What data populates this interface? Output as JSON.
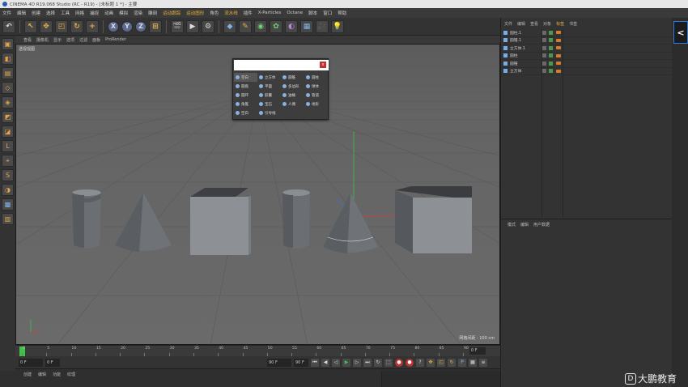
{
  "title_bar": {
    "text": "CINEMA 4D R19.068 Studio (RC - R19) - [未标题 1 *] - 主要"
  },
  "menu": {
    "items": [
      "文件",
      "编辑",
      "创建",
      "选择",
      "工具",
      "网格",
      "捕捉",
      "动画",
      "模拟",
      "渲染",
      "雕刻",
      "运动跟踪",
      "运动图形",
      "角色",
      "流水线",
      "插件",
      "X-Particles",
      "Octane",
      "脚本",
      "窗口",
      "帮助"
    ],
    "highlighted": [
      "运动跟踪",
      "运动图形",
      "流水线"
    ]
  },
  "toolbar": {
    "undo_icon": "undo-icon",
    "axis_labels": [
      "X",
      "Y",
      "Z"
    ]
  },
  "viewport": {
    "menu": [
      "查看",
      "摄像机",
      "显示",
      "选项",
      "过滤",
      "面板",
      "ProRender"
    ],
    "label": "透视视图",
    "grid_info": "网格间距 : 100 cm",
    "colors": {
      "background": "#646464",
      "grid": "#595959",
      "y_axis": "#3fc24a",
      "x_axis": "#d43c3c"
    }
  },
  "popup": {
    "search_value": "",
    "close_label": "x",
    "items": [
      {
        "label": "空白",
        "selected": true
      },
      {
        "label": "立方体"
      },
      {
        "label": "圆锥"
      },
      {
        "label": "圆柱"
      },
      {
        "label": "圆盘"
      },
      {
        "label": "平面"
      },
      {
        "label": "多边形"
      },
      {
        "label": "球体"
      },
      {
        "label": "圆环"
      },
      {
        "label": "胶囊"
      },
      {
        "label": "油桶"
      },
      {
        "label": "管道"
      },
      {
        "label": "角锥"
      },
      {
        "label": "宝石"
      },
      {
        "label": "人偶"
      },
      {
        "label": "地形"
      },
      {
        "label": "空白"
      },
      {
        "label": "引导线"
      }
    ]
  },
  "object_manager": {
    "tabs": [
      "文件",
      "编辑",
      "查看",
      "对象",
      "标签",
      "书签"
    ],
    "highlighted_tab": "标签",
    "objects": [
      "圆柱.1",
      "圆锥.1",
      "立方体.1",
      "圆柱",
      "圆锥",
      "立方体"
    ]
  },
  "attribute_manager": {
    "tabs": [
      "模式",
      "编辑",
      "用户数据"
    ]
  },
  "right_badge": "<",
  "timeline": {
    "ticks": [
      "0",
      "5",
      "10",
      "15",
      "20",
      "25",
      "30",
      "35",
      "40",
      "45",
      "50",
      "55",
      "60",
      "65",
      "70",
      "75",
      "80",
      "85",
      "90"
    ],
    "end_value": "0 F"
  },
  "transport": {
    "start_field": "0 F",
    "current_field": "0 F",
    "end_field": "90 F",
    "max_field": "90 F"
  },
  "material_manager": {
    "tabs": [
      "创建",
      "编辑",
      "功能",
      "纹理"
    ]
  },
  "watermark": {
    "icon": "D",
    "text": "大鹏教育"
  }
}
